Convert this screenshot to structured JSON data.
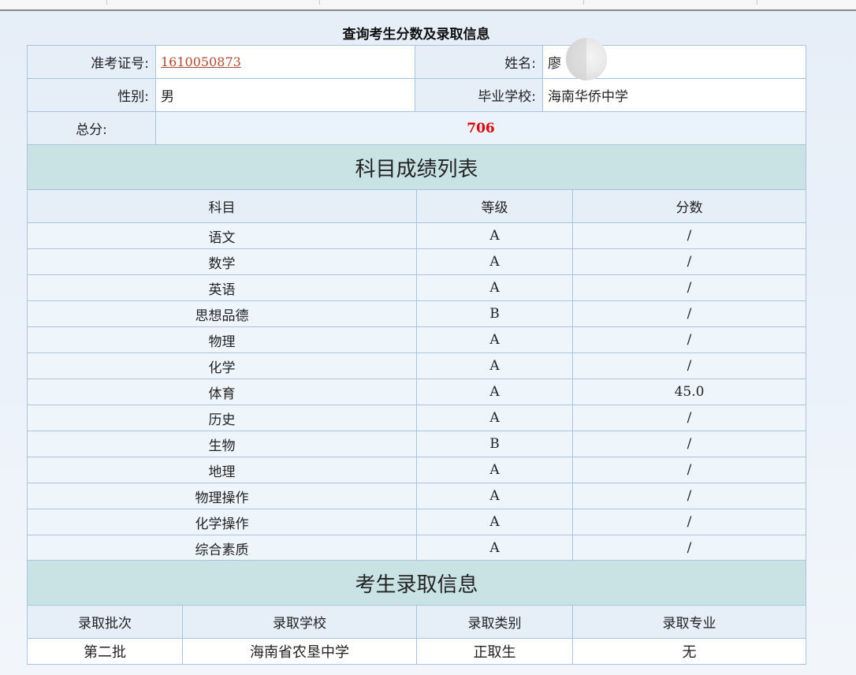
{
  "page_title": "查询考生分数及录取信息",
  "info": {
    "exam_no_label": "准考证号:",
    "exam_no": "1610050873",
    "name_label": "姓名:",
    "name": "廖",
    "gender_label": "性别:",
    "gender": "男",
    "school_label": "毕业学校:",
    "school": "海南华侨中学",
    "total_label": "总分:",
    "total": "706"
  },
  "scores": {
    "section_title": "科目成绩列表",
    "headers": [
      "科目",
      "等级",
      "分数"
    ],
    "rows": [
      {
        "subject": "语文",
        "grade": "A",
        "score": "/"
      },
      {
        "subject": "数学",
        "grade": "A",
        "score": "/"
      },
      {
        "subject": "英语",
        "grade": "A",
        "score": "/"
      },
      {
        "subject": "思想品德",
        "grade": "B",
        "score": "/"
      },
      {
        "subject": "物理",
        "grade": "A",
        "score": "/"
      },
      {
        "subject": "化学",
        "grade": "A",
        "score": "/"
      },
      {
        "subject": "体育",
        "grade": "A",
        "score": "45.0"
      },
      {
        "subject": "历史",
        "grade": "A",
        "score": "/"
      },
      {
        "subject": "生物",
        "grade": "B",
        "score": "/"
      },
      {
        "subject": "地理",
        "grade": "A",
        "score": "/"
      },
      {
        "subject": "物理操作",
        "grade": "A",
        "score": "/"
      },
      {
        "subject": "化学操作",
        "grade": "A",
        "score": "/"
      },
      {
        "subject": "综合素质",
        "grade": "A",
        "score": "/"
      }
    ]
  },
  "admission": {
    "section_title": "考生录取信息",
    "headers": [
      "录取批次",
      "录取学校",
      "录取类别",
      "录取专业"
    ],
    "batch": "第二批",
    "school": "海南省农垦中学",
    "category": "正取生",
    "major": "无"
  },
  "colors": {
    "link": "#b04a2f",
    "total": "#e00000",
    "section_bg": "#c9e3e5",
    "border": "#a9c3e2"
  }
}
